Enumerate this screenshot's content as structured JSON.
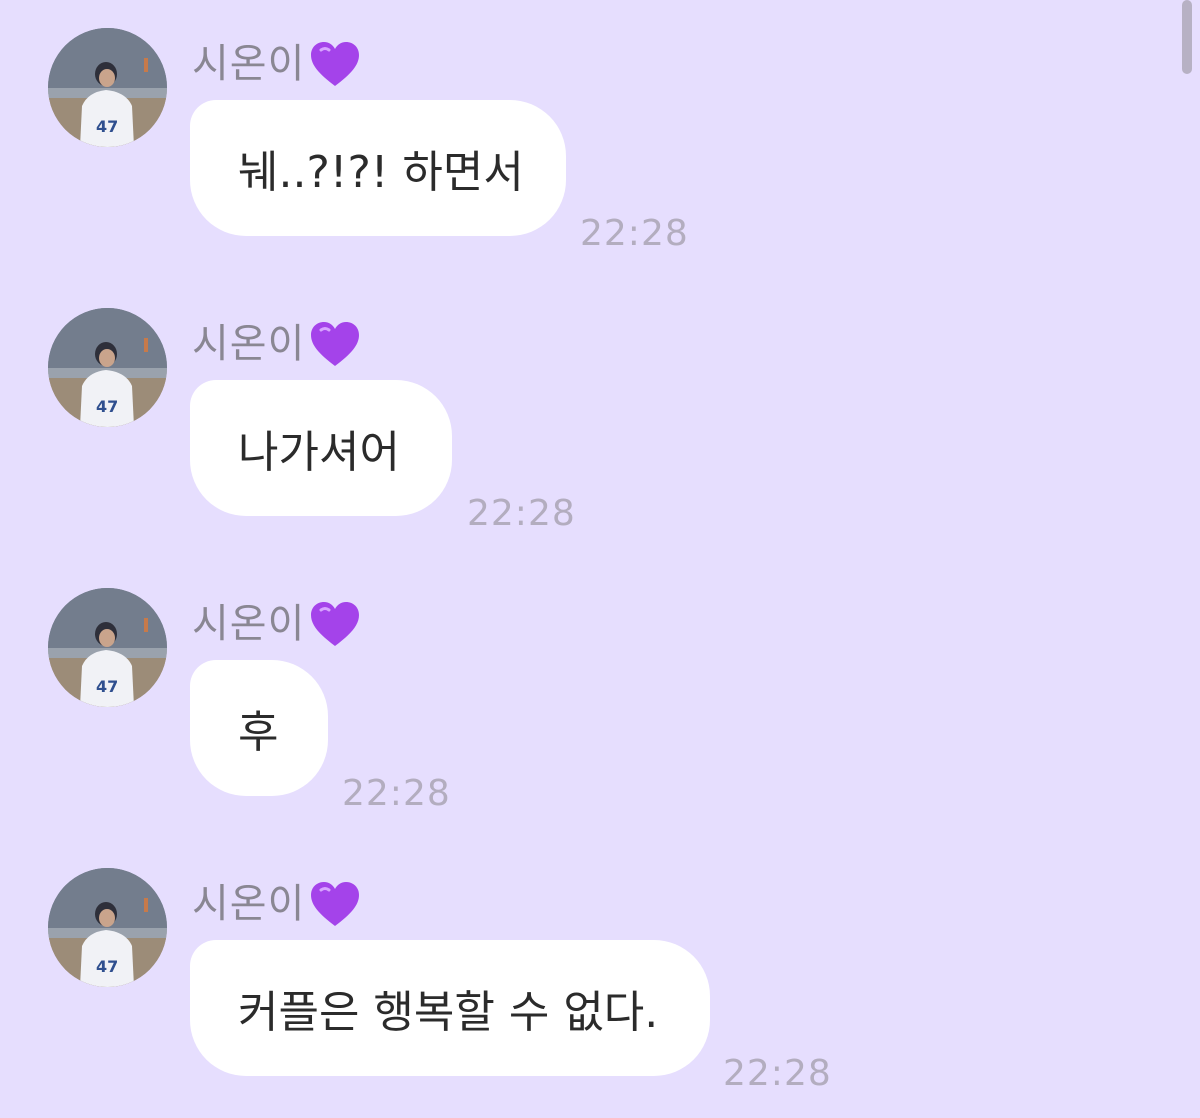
{
  "colors": {
    "background": "#e6defe",
    "bubble": "#ffffff",
    "sender_name": "#8a8793",
    "timestamp": "#b3adbf",
    "heart": "#a443ea"
  },
  "messages": [
    {
      "sender": "시온이",
      "sender_icon": "purple-heart-icon",
      "text": "눼..?!?! 하면서",
      "time": "22:28"
    },
    {
      "sender": "시온이",
      "sender_icon": "purple-heart-icon",
      "text": "나가셔어",
      "time": "22:28"
    },
    {
      "sender": "시온이",
      "sender_icon": "purple-heart-icon",
      "text": "후",
      "time": "22:28"
    },
    {
      "sender": "시온이",
      "sender_icon": "purple-heart-icon",
      "text": "커플은 행복할 수 없다.",
      "time": "22:28"
    }
  ]
}
